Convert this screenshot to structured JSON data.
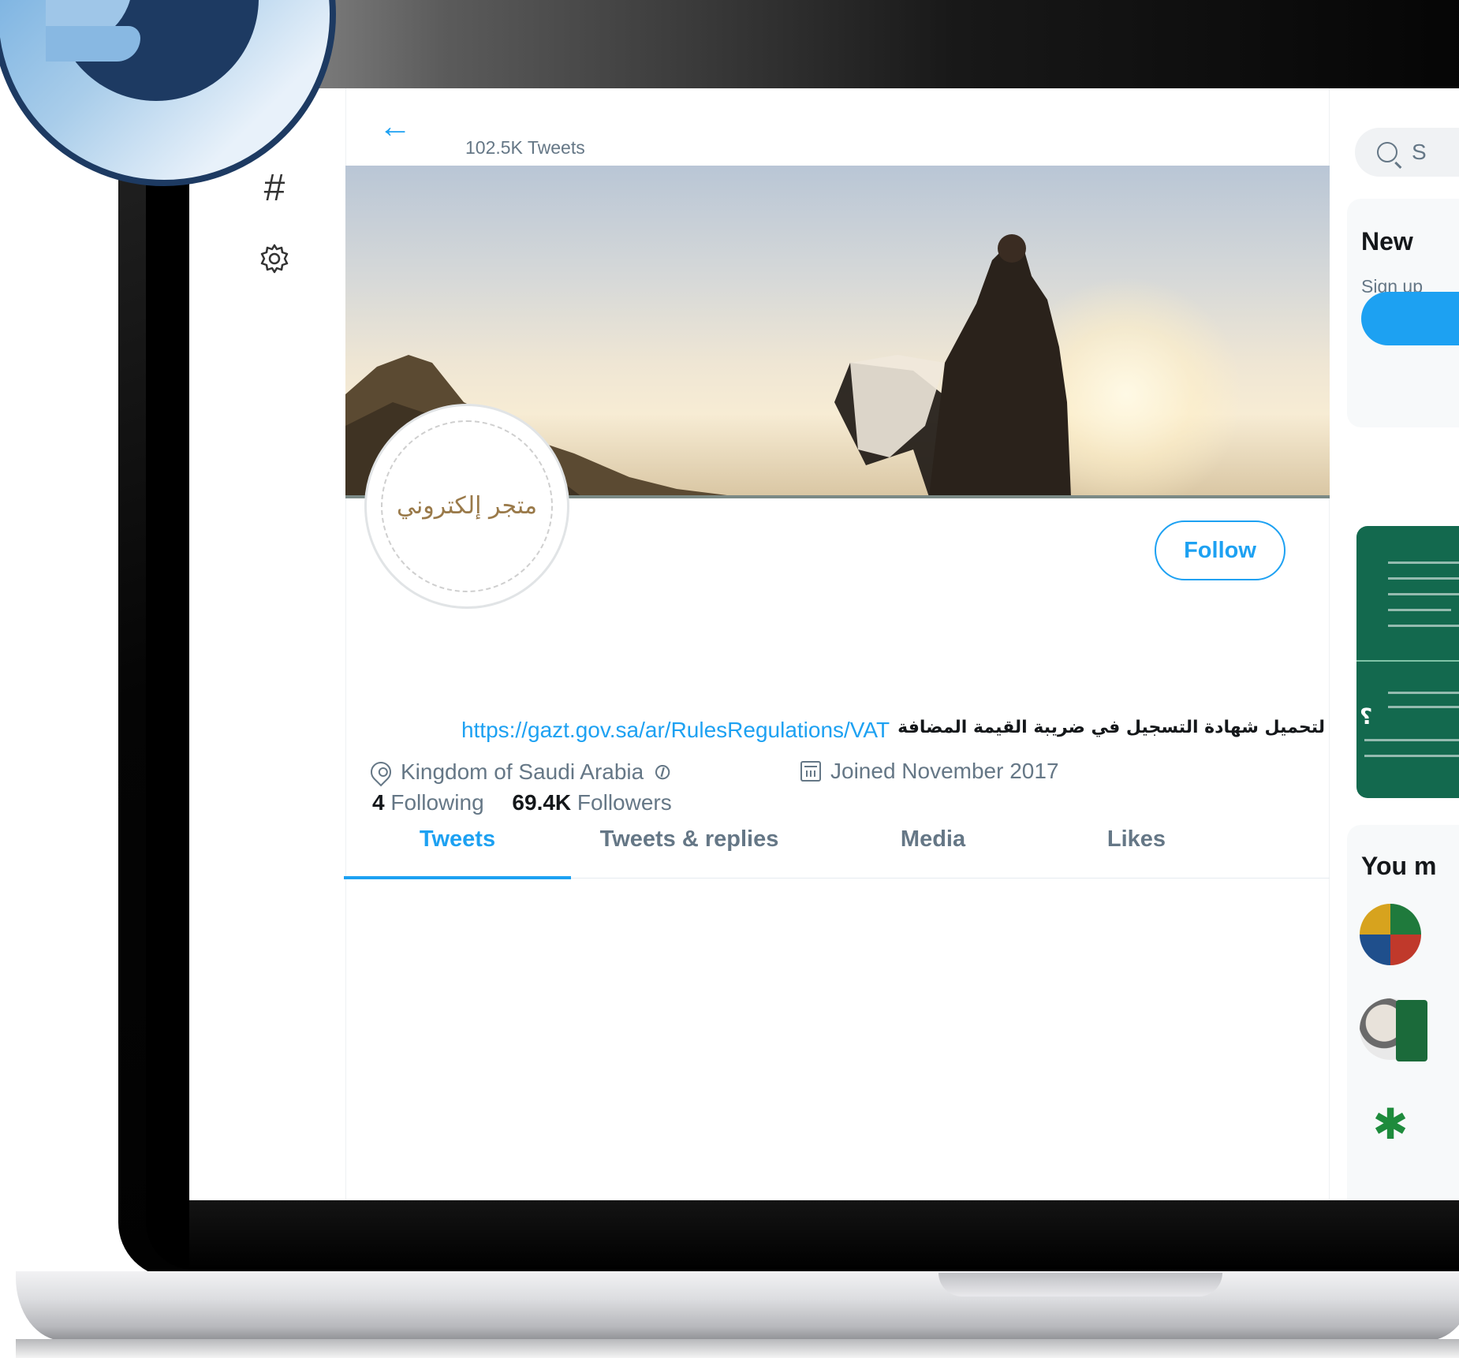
{
  "profile": {
    "tweets_count": "102.5K Tweets",
    "avatar_text": "متجر إلكتروني",
    "follow_label": "Follow",
    "bio_arabic": "لتحميل شهادة التسجيل في ضريبة القيمة المضافة",
    "bio_link": "https://gazt.gov.sa/ar/RulesRegulations/VAT",
    "location": "Kingdom of Saudi Arabia",
    "joined": "Joined November 2017",
    "following_count": "4",
    "following_label": "Following",
    "followers_count": "69.4K",
    "followers_label": "Followers"
  },
  "tabs": [
    {
      "label": "Tweets",
      "active": true
    },
    {
      "label": "Tweets & replies",
      "active": false
    },
    {
      "label": "Media",
      "active": false
    },
    {
      "label": "Likes",
      "active": false
    }
  ],
  "sidebar": {
    "search_placeholder": "S",
    "new_title": "New",
    "new_sub": "Sign up",
    "you_title": "You m"
  },
  "icons": {
    "back": "back-arrow-icon",
    "explore": "hashtag-icon",
    "settings": "gear-icon",
    "search": "search-icon",
    "location": "location-pin-icon",
    "link": "link-icon",
    "calendar": "calendar-icon",
    "logo": "twitter-bird-icon"
  },
  "colors": {
    "accent": "#1da1f2",
    "muted": "#657786",
    "logo_ring": "#1d3a62"
  }
}
